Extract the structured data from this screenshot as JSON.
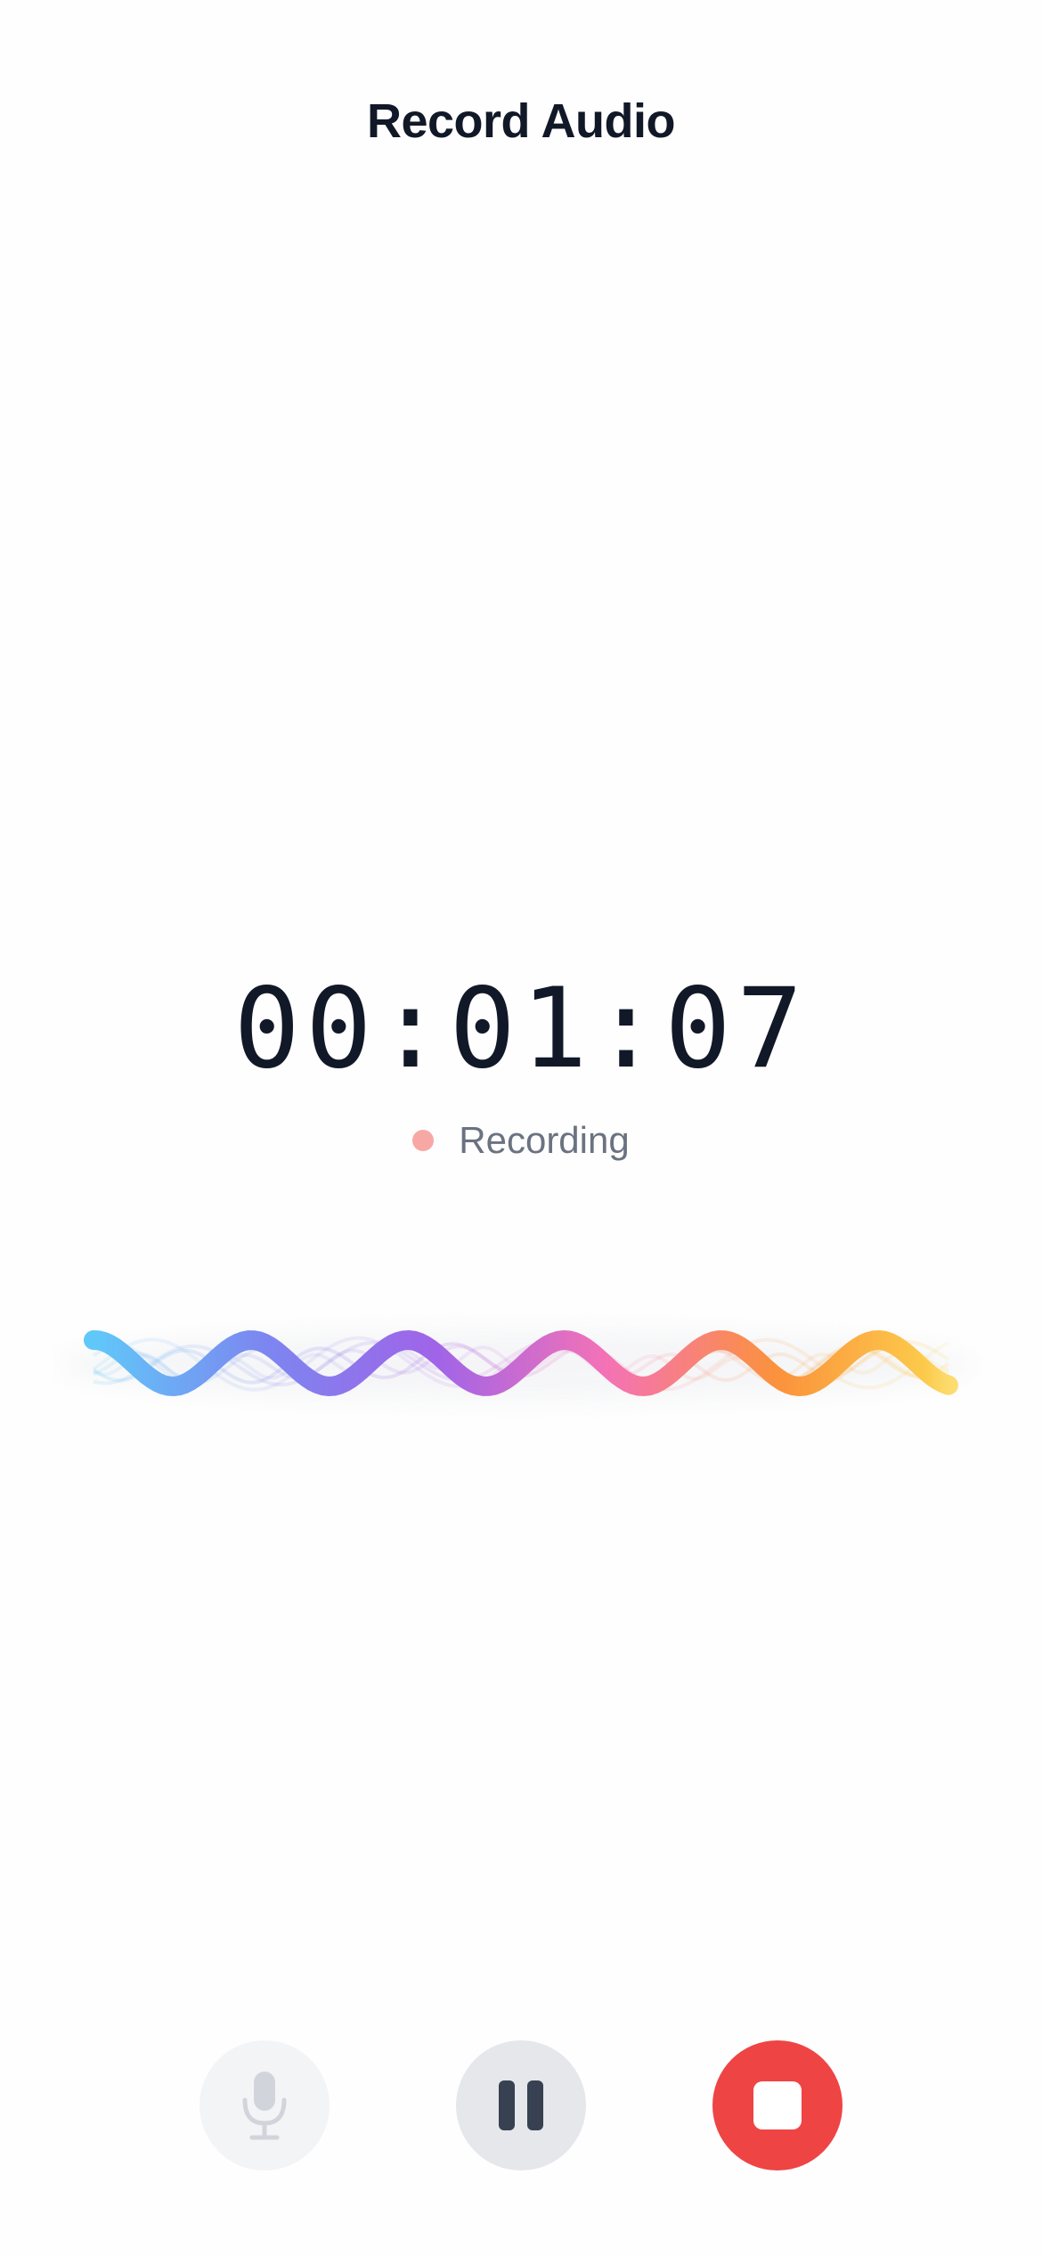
{
  "header": {
    "title": "Record Audio"
  },
  "recorder": {
    "elapsed": "00:01:07",
    "status": "Recording",
    "status_dot_color": "#f7a8a5"
  },
  "waveform": {
    "gradient_colors": [
      "#60c8f8",
      "#7c86f0",
      "#a064e8",
      "#f472b6",
      "#fb923c",
      "#fcd34d"
    ]
  },
  "controls": {
    "mic": {
      "icon": "microphone-icon",
      "enabled": false
    },
    "pause": {
      "icon": "pause-icon"
    },
    "stop": {
      "icon": "stop-icon",
      "color": "#ef4444"
    }
  }
}
